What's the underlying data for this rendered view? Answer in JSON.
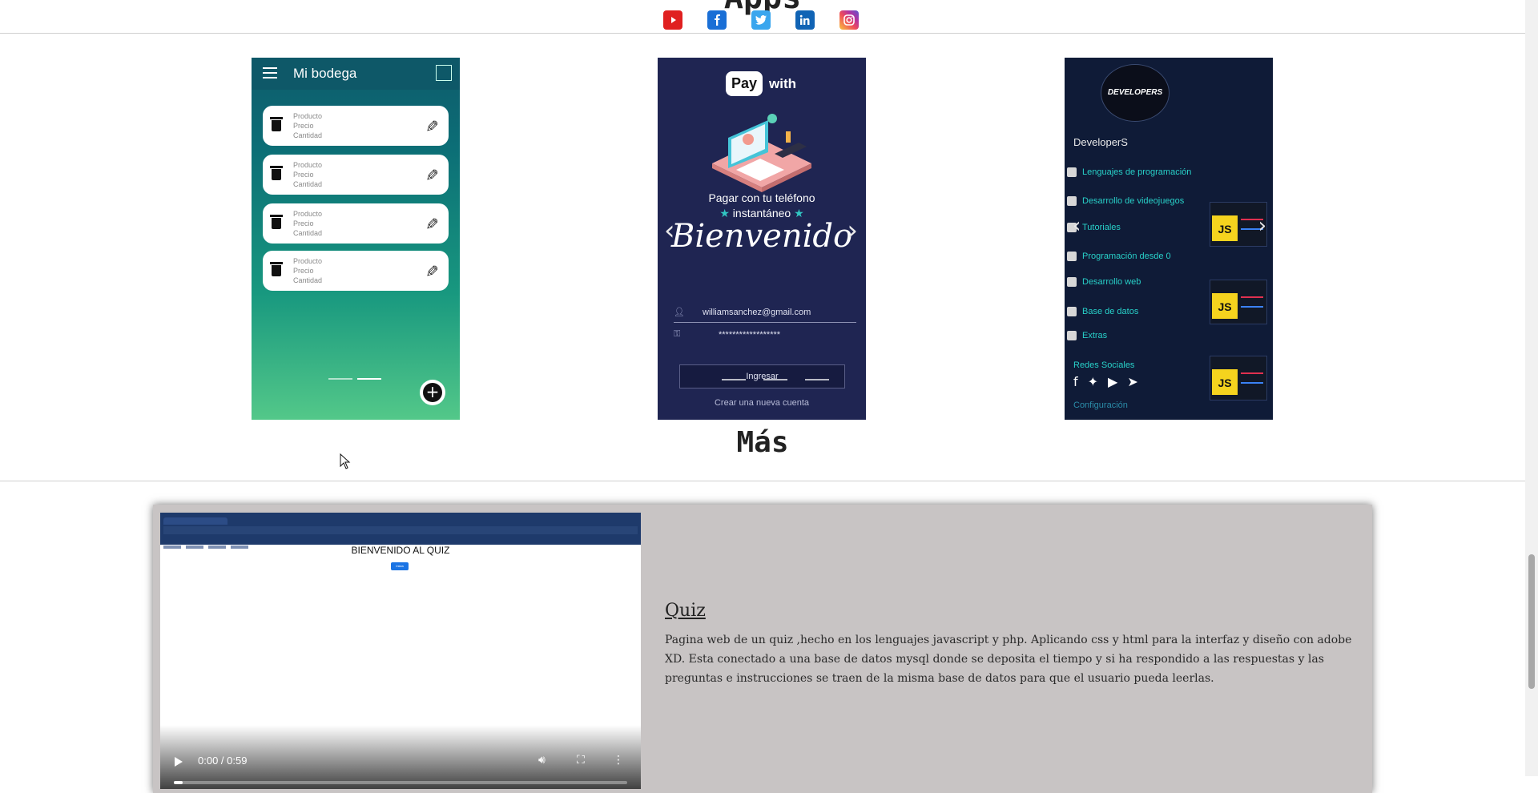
{
  "section_apps": {
    "title": "Apps",
    "social_icons": [
      "youtube-icon",
      "facebook-icon",
      "twitter-icon",
      "linkedin-icon",
      "instagram-icon"
    ],
    "phones": [
      {
        "app_title": "Mi bodega",
        "item_lines": [
          "Producto",
          "Precio",
          "Cantidad"
        ]
      },
      {
        "pay_box": "Pay",
        "pay_with": "with",
        "tagline_1": "Pagar con tu teléfono",
        "tagline_2": "instantáneo",
        "welcome": "Bienvenido",
        "email": "williamsanchez@gmail.com",
        "password": "******************",
        "login_button": "Ingresar",
        "create_account": "Crear una nueva cuenta"
      },
      {
        "logo_text": "DEVELOPERS",
        "brand": "DeveloperS",
        "menu": [
          "Lenguajes de programación",
          "Desarrollo de videojuegos",
          "Tutoriales",
          "Programación desde 0",
          "Desarrollo web",
          "Base de datos",
          "Extras"
        ],
        "social_label": "Redes Sociales",
        "settings_label": "Configuración",
        "thumb_badge": "JS"
      }
    ]
  },
  "section_more": {
    "title": "Más",
    "quiz": {
      "video": {
        "page_heading": "BIENVENIDO AL QUIZ",
        "page_button": "Inicia",
        "time": "0:00 / 0:59",
        "progress": 0.0
      },
      "title": "Quiz",
      "description": "Pagina web de un quiz ,hecho en los lenguajes javascript y php. Aplicando css y html para la interfaz y diseño con adobe XD. Esta conectado a una base de datos mysql donde se deposita el tiempo y si ha respondido a las respuestas y las preguntas e instrucciones se traen de la misma base de datos para que el usuario pueda leerlas."
    }
  },
  "colors": {
    "youtube": "#e02020",
    "facebook": "#1a6fd6",
    "twitter": "#3aa6ee",
    "linkedin": "#1164b5",
    "quiz_card_bg": "#c8c4c4",
    "developers_accent": "#28d0c8"
  }
}
